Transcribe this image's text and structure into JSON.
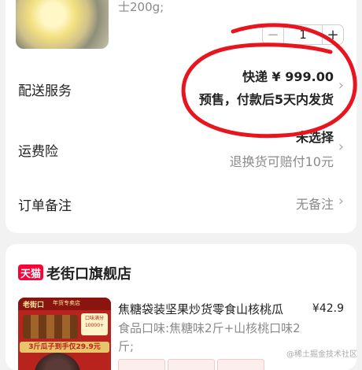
{
  "order_item": {
    "spec_text": "士200g;",
    "quantity": "1",
    "minus_label": "−",
    "plus_label": "+"
  },
  "delivery": {
    "label": "配送服务",
    "price_line": "快递 ¥ 999.00",
    "note_line": "预售，付款后5天内发货"
  },
  "insurance": {
    "label": "运费险",
    "status": "未选择",
    "description": "退换货可赔付10元"
  },
  "remark": {
    "label": "订单备注",
    "value": "无备注"
  },
  "chevron": "›",
  "shop": {
    "badge": "天猫",
    "name": "老街口旗舰店"
  },
  "product": {
    "title": "焦糖袋装坚果炒货零食山核桃瓜",
    "price": "¥42.9",
    "spec": "食品口味:焦糖味2斤+山核桃口味2斤;",
    "image_logo": "老街口",
    "image_tagline": "年货专卖店",
    "image_badge": "口味满分 10000+",
    "image_promo": "3斤瓜子到手仅29.9元"
  },
  "watermark": "@稀土掘金技术社区",
  "annotation_color": "#e8141e"
}
